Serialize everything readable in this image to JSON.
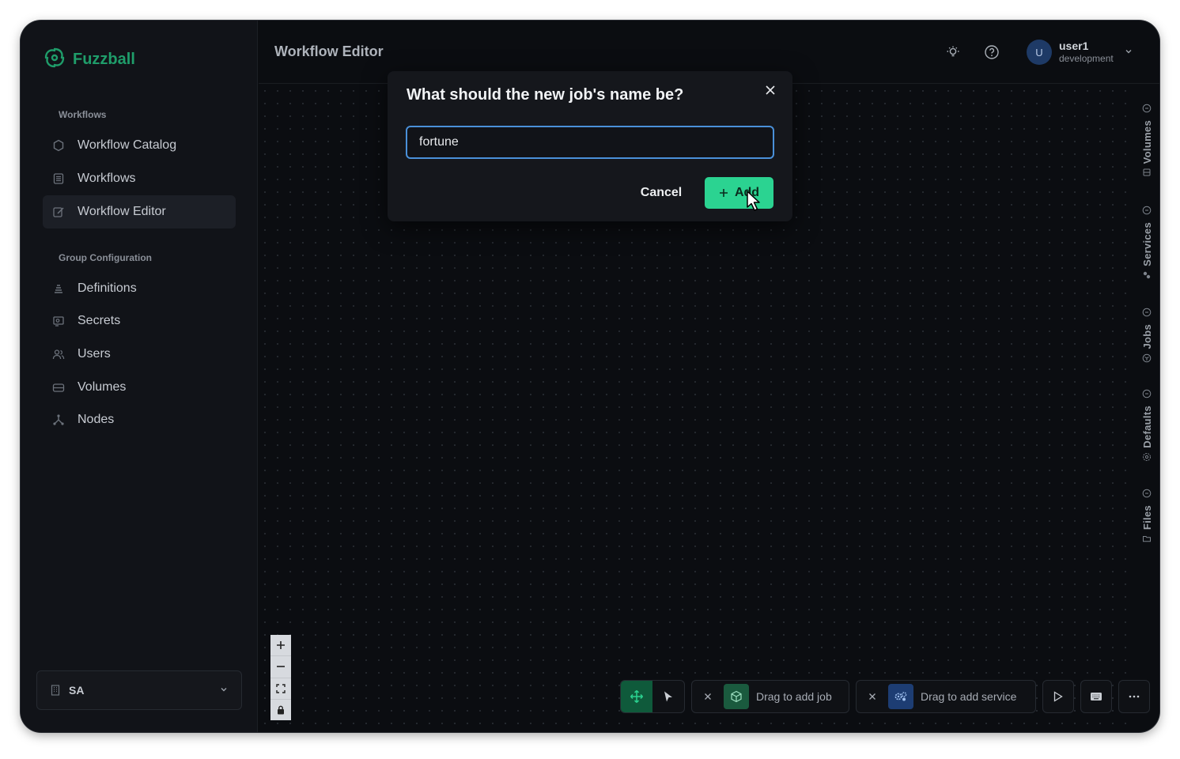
{
  "app": {
    "brand": "Fuzzball",
    "accent": "#2bd391",
    "brand_color": "#1f9d6a"
  },
  "sidebar": {
    "workflows_label": "Workflows",
    "workflow_items": [
      {
        "label": "Workflow Catalog",
        "icon": "hexagon-icon"
      },
      {
        "label": "Workflows",
        "icon": "list-icon"
      },
      {
        "label": "Workflow Editor",
        "icon": "edit-icon",
        "active": true
      }
    ],
    "group_label": "Group Configuration",
    "group_items": [
      {
        "label": "Definitions",
        "icon": "stack-icon"
      },
      {
        "label": "Secrets",
        "icon": "key-icon"
      },
      {
        "label": "Users",
        "icon": "users-icon"
      },
      {
        "label": "Volumes",
        "icon": "drive-icon"
      },
      {
        "label": "Nodes",
        "icon": "nodes-icon"
      }
    ],
    "org": {
      "label": "SA",
      "icon": "building-icon"
    }
  },
  "header": {
    "title": "Workflow Editor",
    "user": {
      "initial": "U",
      "name": "user1",
      "env": "development"
    }
  },
  "right_tabs": [
    "Volumes",
    "Services",
    "Jobs",
    "Defaults",
    "Files"
  ],
  "toolbar": {
    "add_job": "Drag to add job",
    "add_service": "Drag to add service"
  },
  "dialog": {
    "title": "What should the new job's name be?",
    "input_value": "fortune",
    "cancel": "Cancel",
    "add": "Add"
  }
}
